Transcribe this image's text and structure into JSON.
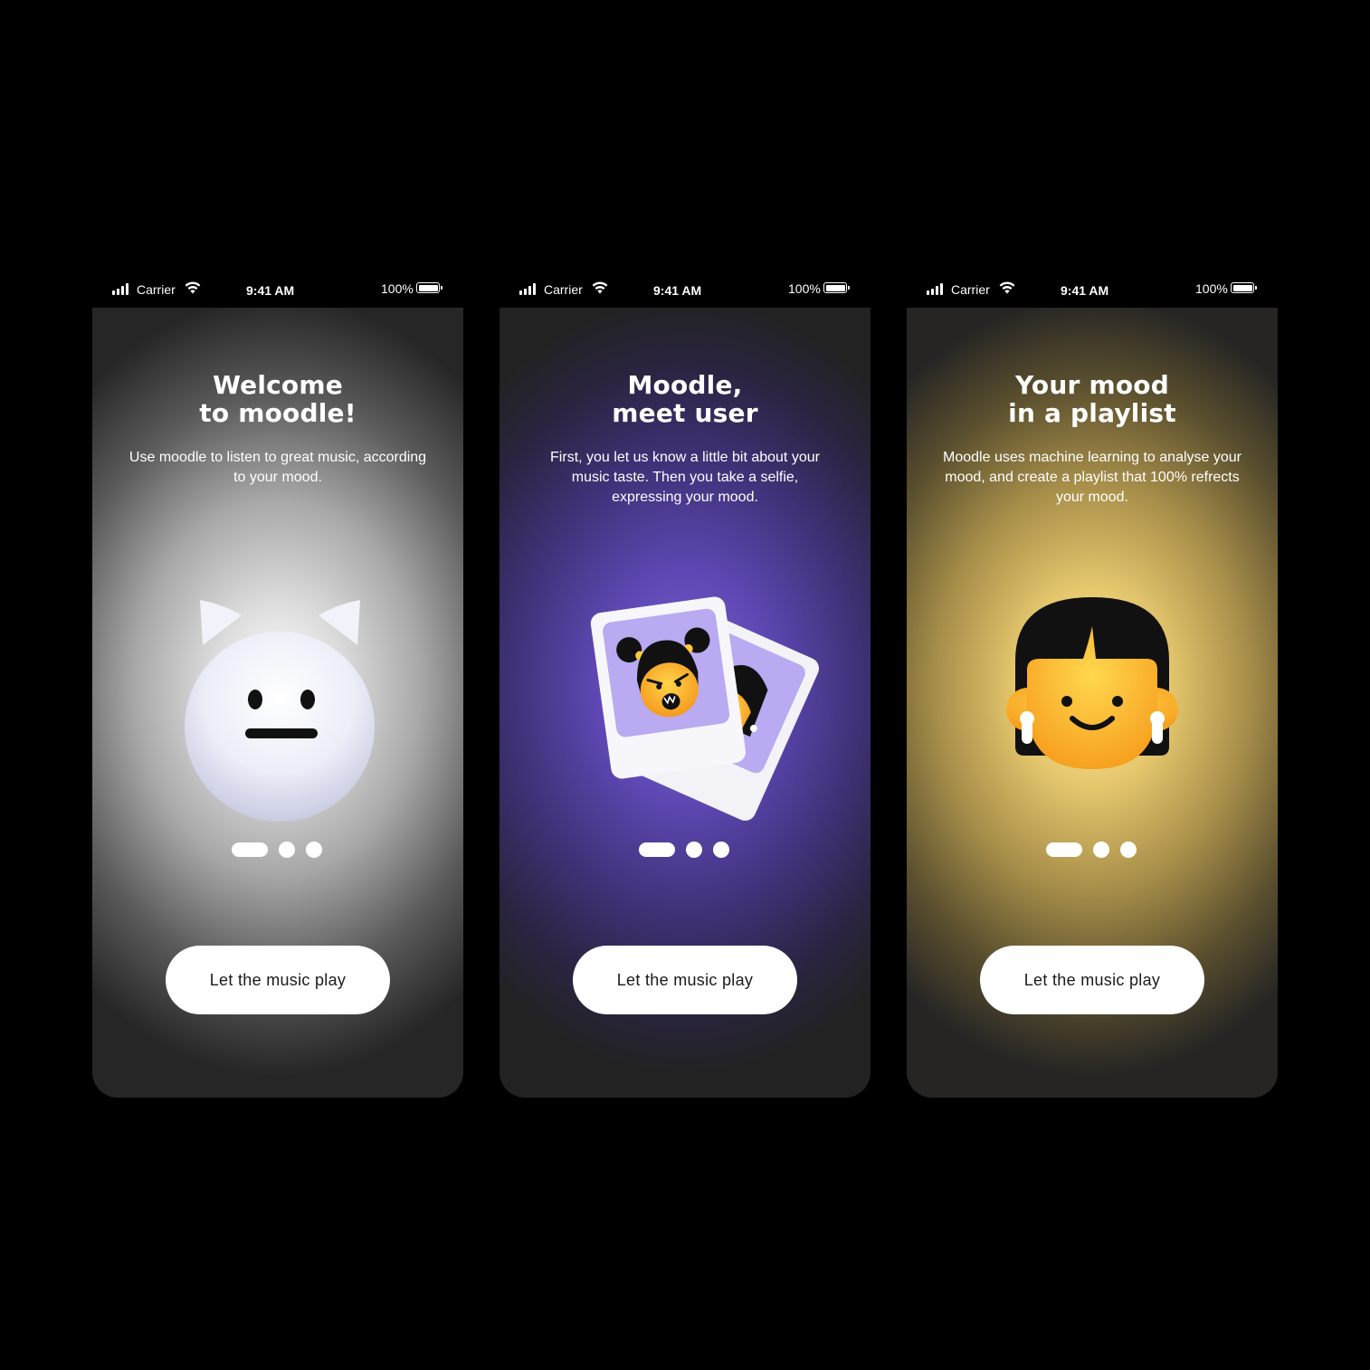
{
  "status_bar": {
    "carrier": "Carrier",
    "time": "9:41 AM",
    "battery": "100%"
  },
  "screens": [
    {
      "title_line1": "Welcome",
      "title_line2": "to moodle!",
      "description": "Use moodle to listen to great music, according to your mood.",
      "illustration": "white-cat-face-icon",
      "button_label": "Let the music play",
      "accent": "#ffffff"
    },
    {
      "title_line1": "Moodle,",
      "title_line2": "meet user",
      "description": "First, you let us know a little bit about your music taste. Then you take a selfie, expressing your mood.",
      "illustration": "selfie-photos-icon",
      "button_label": "Let the music play",
      "accent": "#7a62d6"
    },
    {
      "title_line1": "Your mood",
      "title_line2": "in a playlist",
      "description": "Moodle uses machine learning to analyse your mood, and create a playlist that 100% refrects your mood.",
      "illustration": "smiling-face-earbuds-icon",
      "button_label": "Let the music play",
      "accent": "#f5b52a"
    }
  ],
  "pagination": {
    "pages": 3,
    "active": 1
  }
}
